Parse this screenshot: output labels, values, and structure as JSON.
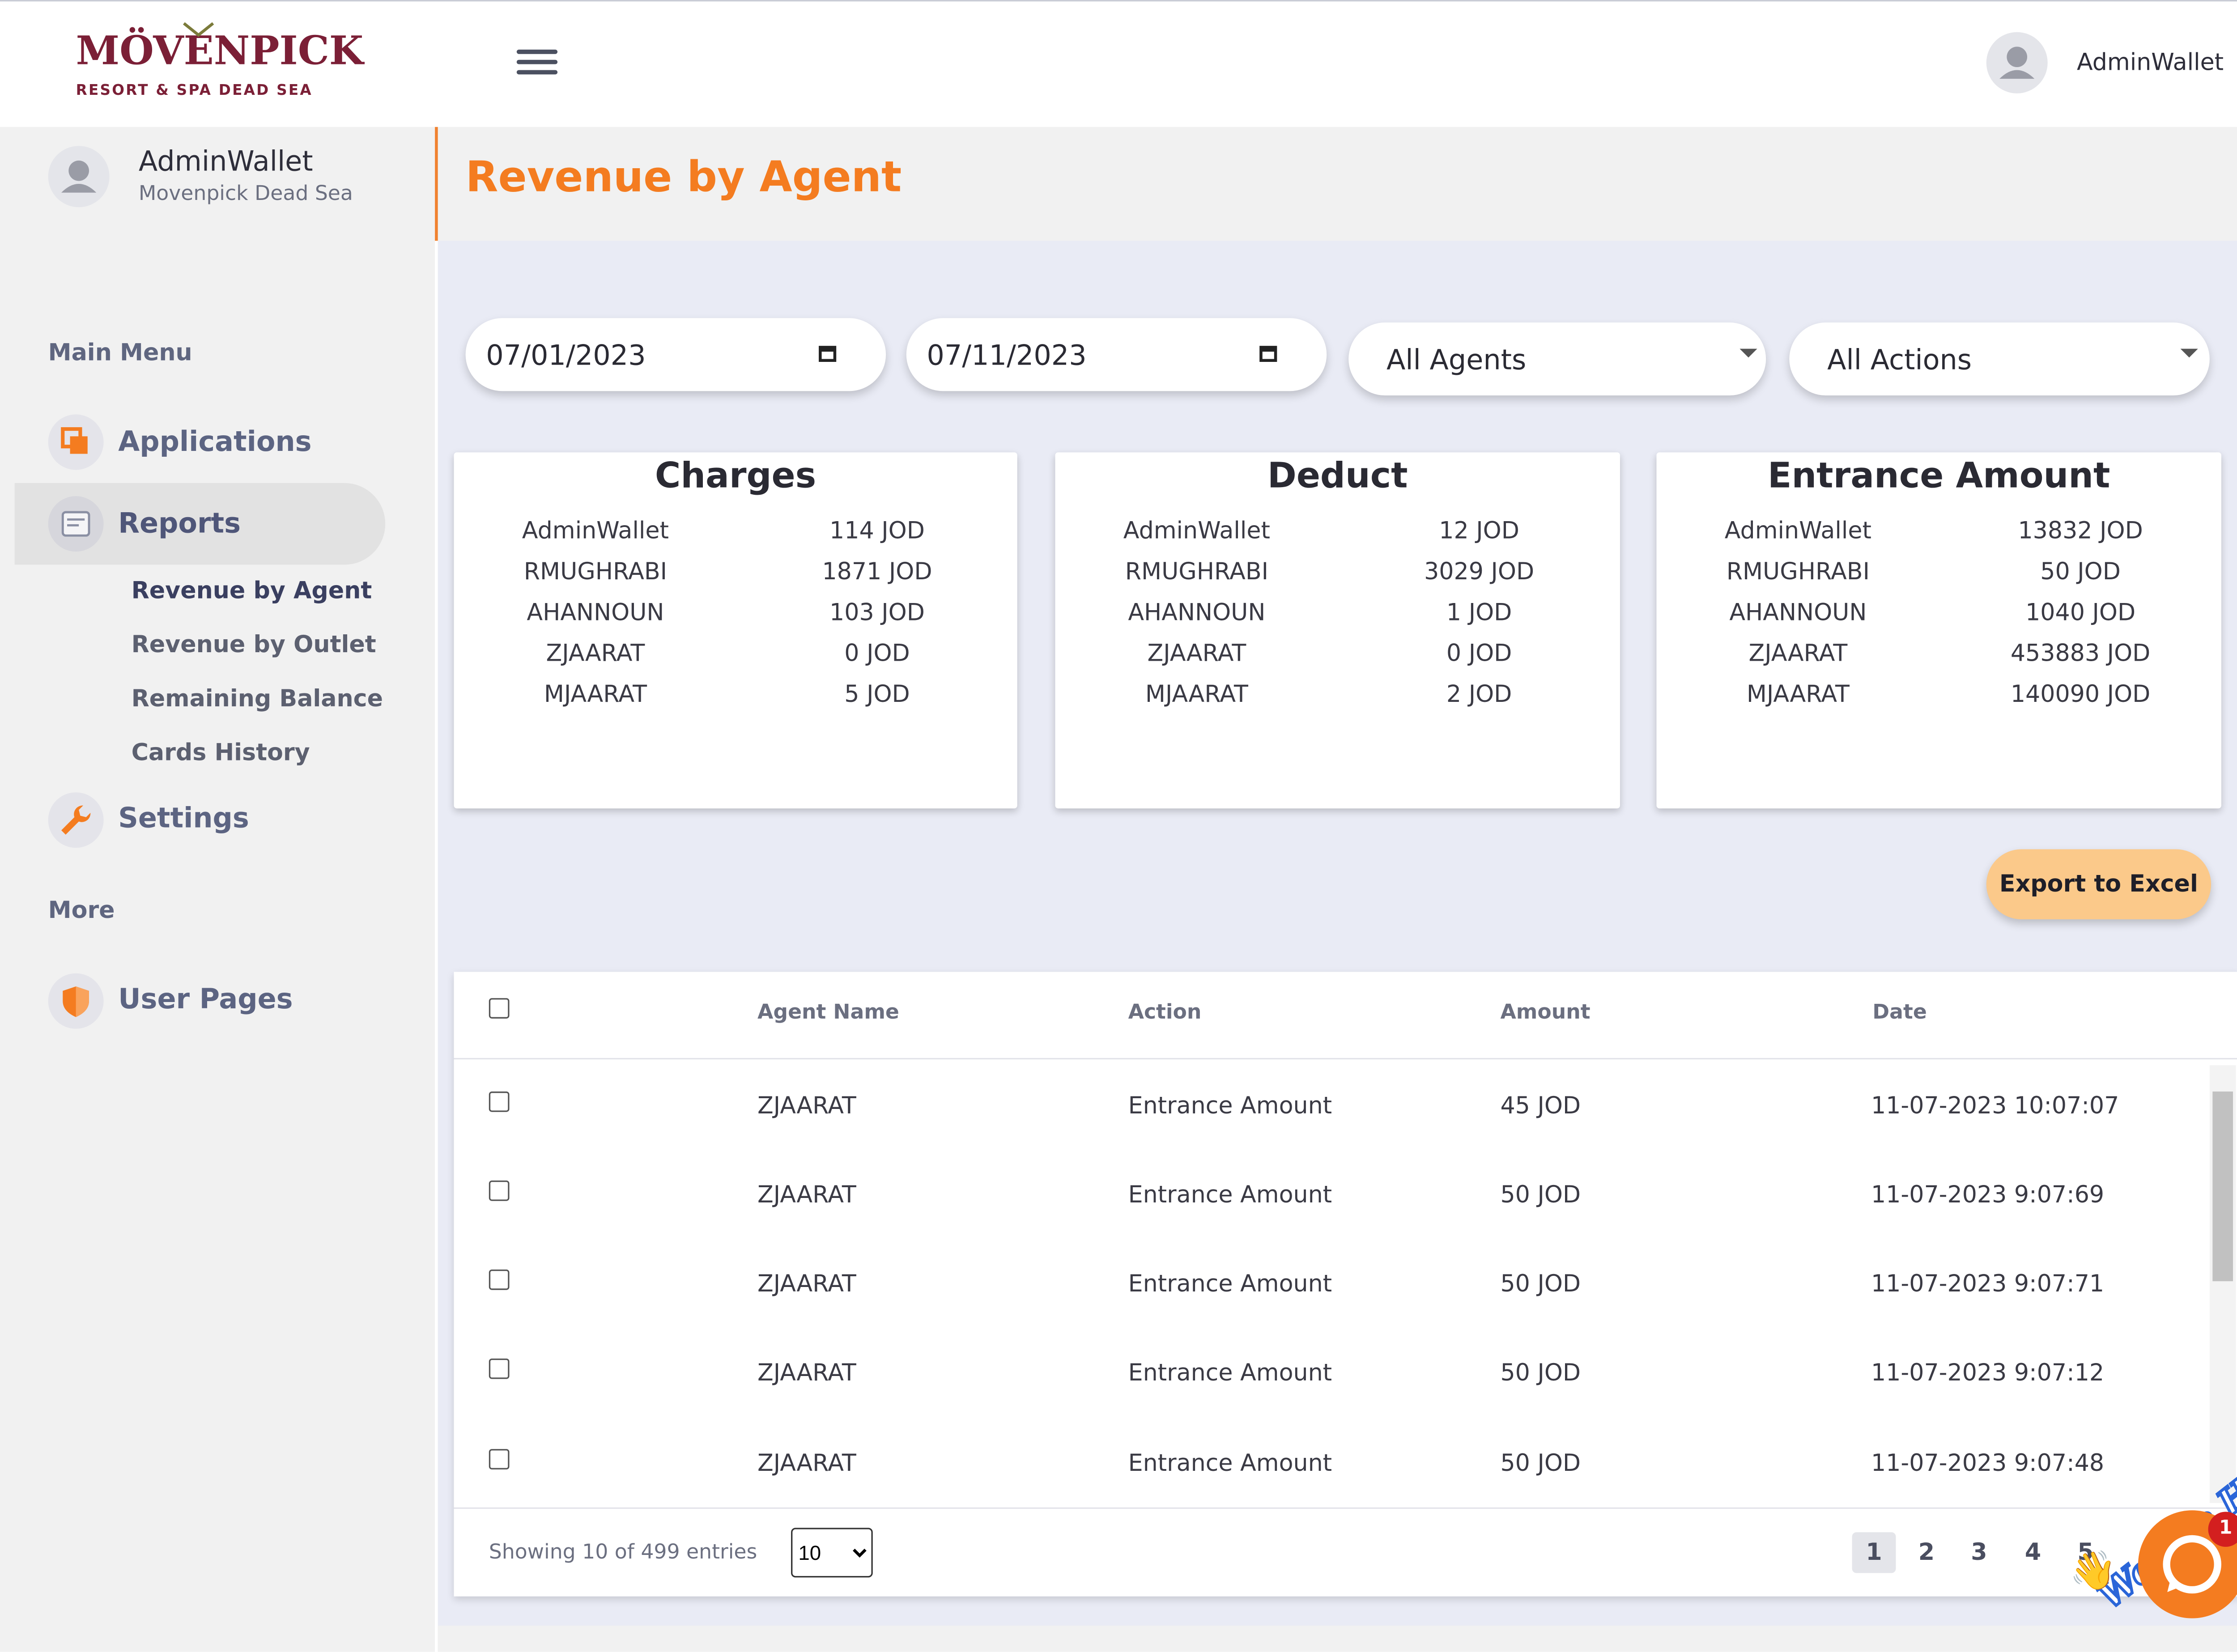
{
  "brand": {
    "logo_text": "MÖVENPICK",
    "logo_sub": "RESORT & SPA DEAD SEA"
  },
  "header": {
    "user_name": "AdminWallet",
    "more": "···"
  },
  "sidebar": {
    "user_name": "AdminWallet",
    "hotel": "Movenpick Dead Sea",
    "main_menu_label": "Main Menu",
    "applications": "Applications",
    "reports": "Reports",
    "submenu": [
      "Revenue by Agent",
      "Revenue by Outlet",
      "Remaining Balance",
      "Cards History"
    ],
    "settings": "Settings",
    "more_label": "More",
    "user_pages": "User Pages"
  },
  "page": {
    "title": "Revenue by Agent"
  },
  "filters": {
    "date_from": "07/01/2023",
    "date_to": "07/11/2023",
    "agent": "All Agents",
    "action": "All Actions"
  },
  "cards": [
    {
      "title": "Charges",
      "rows": [
        [
          "AdminWallet",
          "114 JOD"
        ],
        [
          "RMUGHRABI",
          "1871 JOD"
        ],
        [
          "AHANNOUN",
          "103 JOD"
        ],
        [
          "ZJAARAT",
          "0 JOD"
        ],
        [
          "MJAARAT",
          "5 JOD"
        ]
      ]
    },
    {
      "title": "Deduct",
      "rows": [
        [
          "AdminWallet",
          "12 JOD"
        ],
        [
          "RMUGHRABI",
          "3029 JOD"
        ],
        [
          "AHANNOUN",
          "1 JOD"
        ],
        [
          "ZJAARAT",
          "0 JOD"
        ],
        [
          "MJAARAT",
          "2 JOD"
        ]
      ]
    },
    {
      "title": "Entrance Amount",
      "rows": [
        [
          "AdminWallet",
          "13832 JOD"
        ],
        [
          "RMUGHRABI",
          "50 JOD"
        ],
        [
          "AHANNOUN",
          "1040 JOD"
        ],
        [
          "ZJAARAT",
          "453883 JOD"
        ],
        [
          "MJAARAT",
          "140090 JOD"
        ]
      ]
    }
  ],
  "export_label": "Export to Excel",
  "table": {
    "columns": [
      "Agent Name",
      "Action",
      "Amount",
      "Date"
    ],
    "rows": [
      [
        "ZJAARAT",
        "Entrance Amount",
        "45 JOD",
        "11-07-2023 10:07:07"
      ],
      [
        "ZJAARAT",
        "Entrance Amount",
        "50 JOD",
        "11-07-2023 9:07:69"
      ],
      [
        "ZJAARAT",
        "Entrance Amount",
        "50 JOD",
        "11-07-2023 9:07:71"
      ],
      [
        "ZJAARAT",
        "Entrance Amount",
        "50 JOD",
        "11-07-2023 9:07:12"
      ],
      [
        "ZJAARAT",
        "Entrance Amount",
        "50 JOD",
        "11-07-2023 9:07:48"
      ]
    ],
    "showing": "Showing 10 of 499 entries",
    "page_size": "10",
    "pages": [
      "1",
      "2",
      "3",
      "4",
      "5"
    ]
  },
  "chat": {
    "banner": "We Are Here!",
    "badge": "1"
  },
  "colors": {
    "accent": "#f47c20",
    "brand": "#7b1f36",
    "export": "#fbc98a"
  }
}
